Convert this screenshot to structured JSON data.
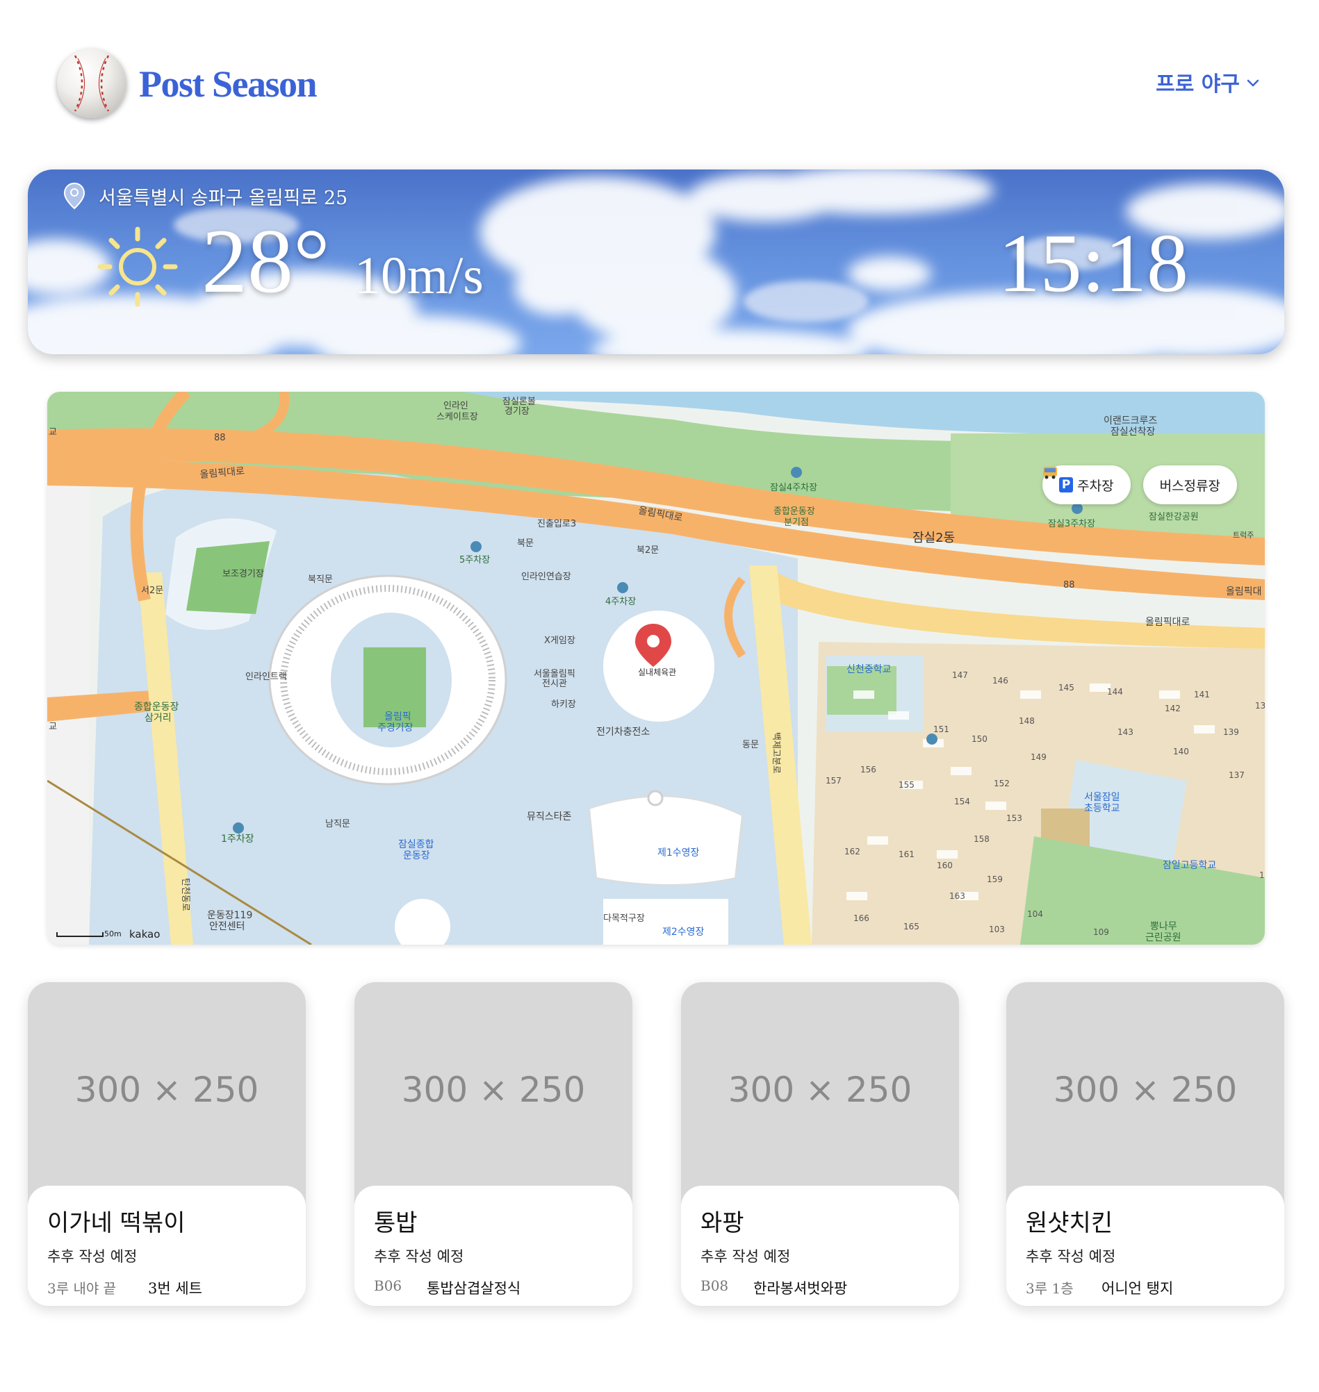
{
  "header": {
    "brand": "Post Season",
    "league_menu": "프로 야구"
  },
  "weather": {
    "location": "서울특별시 송파구 올림픽로 25",
    "temperature": "28°",
    "wind": "10m/s",
    "time": "15:18",
    "condition_icon": "sun-icon"
  },
  "map": {
    "buttons": {
      "parking": "주차장",
      "bus": "버스정류장"
    },
    "selected_place": "실내체육관",
    "scale": "50m",
    "provider": "kakao",
    "labels": {
      "road_olympic_1": "올림픽대로",
      "road_olympic_2": "올림픽대로",
      "road_olympic_3": "올림픽대로",
      "road_olympic_4": "올림픽대",
      "route_88_a": "88",
      "route_88_b": "88",
      "inline_square": "인라인\n스케이트장",
      "jamsil_ball": "잠실론볼\n경기장",
      "eland_cruise": "이랜드크루즈\n잠실선착장",
      "parking_4_jamsil": "잠실4주차장",
      "sports_branch": "종합운동장\n분기점",
      "jamsil2dong": "잠실2동",
      "parking_3_jamsil": "잠실3주차장",
      "hangang_park": "잠실한강공원",
      "truck": "트럭주",
      "entry3": "진출입로3",
      "north_gate": "북문",
      "north_gate2": "북2문",
      "parking_5": "5주차장",
      "aux_stadium": "보조경기장",
      "north_west_gate": "북직문",
      "inline_practice": "인라인연습장",
      "parking_4": "4주차장",
      "west_gate2": "서2문",
      "x_game": "X게임장",
      "olympic_hall": "서울올림픽\n전시관",
      "hockey": "하키장",
      "ev_station": "전기차충전소",
      "inline_track": "인라인트랙",
      "main_stadium": "올림픽\n주경기장",
      "sports_junction": "종합운동장\n삼거리",
      "east_gate": "동문",
      "baekjegobun": "백제고분로",
      "music_star": "뮤직스타존",
      "south_gate": "남직문",
      "parking_1": "1주차장",
      "jamsil_complex": "잠실종합\n운동장",
      "pool_1": "제1수영장",
      "pool_2": "제2수영장",
      "diving": "다목적구장",
      "safety_center": "운동장119\n안전센터",
      "tancheon": "탄천동로",
      "shincheon_middle": "신천중학교",
      "seoul_jamil_elem": "서울잠일\n초등학교",
      "jamil_high": "잠일고등학교",
      "ppongnamu_park": "뽕나무\n근린공원",
      "left_edge_1": "교",
      "left_edge_2": "교"
    },
    "blocks": [
      "147",
      "146",
      "145",
      "144",
      "142",
      "141",
      "148",
      "143",
      "139",
      "140",
      "151",
      "150",
      "149",
      "157",
      "156",
      "155",
      "152",
      "154",
      "137",
      "153",
      "158",
      "162",
      "161",
      "160",
      "159",
      "163",
      "166",
      "165",
      "104",
      "103",
      "109",
      "13",
      "1"
    ]
  },
  "cards": [
    {
      "placeholder": "300 × 250",
      "name": "이가네 떡볶이",
      "desc": "추후 작성 예정",
      "loc": "3루 내야 끝",
      "menu": "3번 세트"
    },
    {
      "placeholder": "300 × 250",
      "name": "통밥",
      "desc": "추후 작성 예정",
      "loc": "B06",
      "menu": "통밥삼겹살정식"
    },
    {
      "placeholder": "300 × 250",
      "name": "와팡",
      "desc": "추후 작성 예정",
      "loc": "B08",
      "menu": "한라봉셔벗와팡"
    },
    {
      "placeholder": "300 × 250",
      "name": "원샷치킨",
      "desc": "추후 작성 예정",
      "loc": "3루 1층",
      "menu": "어니언 탱지"
    }
  ],
  "colors": {
    "brand": "#3b63d6",
    "road": "#f7b26a",
    "park": "#a9d59a",
    "water": "#a9d3ea",
    "venue": "#cfe0ee",
    "pin": "#e04848"
  }
}
